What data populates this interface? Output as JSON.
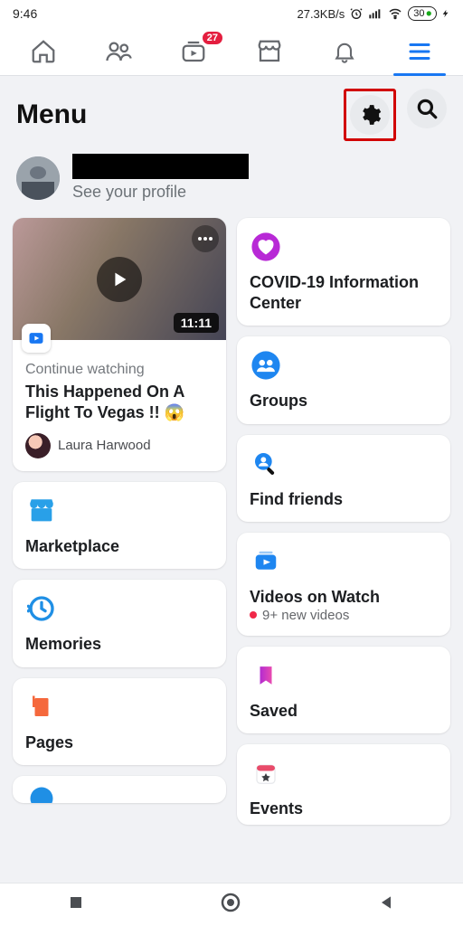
{
  "status": {
    "time": "9:46",
    "net_speed": "27.3KB/s",
    "battery": "30"
  },
  "tabs": {
    "watch_badge": "27"
  },
  "header": {
    "title": "Menu"
  },
  "profile": {
    "subtitle": "See your profile"
  },
  "video_card": {
    "duration": "11:11",
    "subtitle": "Continue watching",
    "title": "This Happened On A Flight To Vegas !! 😱",
    "author": "Laura Harwood"
  },
  "cards_left": {
    "marketplace": "Marketplace",
    "memories": "Memories",
    "pages": "Pages"
  },
  "cards_right": {
    "covid": "COVID-19 Information Center",
    "groups": "Groups",
    "find_friends": "Find friends",
    "videos": "Videos on Watch",
    "videos_sub": "9+ new videos",
    "saved": "Saved",
    "events": "Events"
  }
}
